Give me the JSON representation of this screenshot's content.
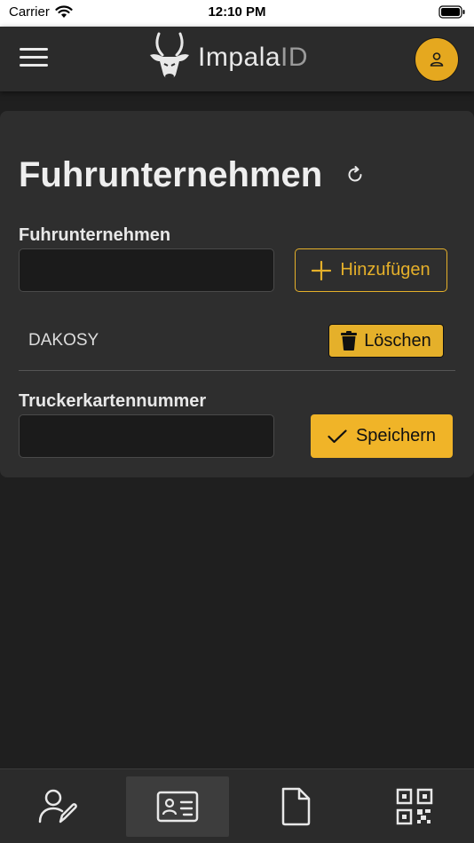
{
  "status_bar": {
    "carrier": "Carrier",
    "time": "12:10 PM"
  },
  "header": {
    "logo_name": "Impala",
    "logo_suffix": "ID",
    "icons": [
      "menu-icon",
      "impala-logo-icon",
      "user-icon"
    ],
    "accent_color": "#e5a81f"
  },
  "main": {
    "title": "Fuhrunternehmen",
    "company_field": {
      "label": "Fuhrunternehmen",
      "value": "",
      "placeholder": ""
    },
    "add_button_label": "Hinzufügen",
    "companies": [
      {
        "name": "DAKOSY",
        "delete_label": "Löschen"
      }
    ],
    "card_number_field": {
      "label": "Truckerkartennummer",
      "value": "",
      "placeholder": ""
    },
    "save_button_label": "Speichern"
  },
  "bottom_nav": {
    "items": [
      {
        "icon": "user-edit-icon",
        "active": false
      },
      {
        "icon": "id-card-icon",
        "active": true
      },
      {
        "icon": "document-icon",
        "active": false
      },
      {
        "icon": "qr-code-icon",
        "active": false
      }
    ]
  }
}
